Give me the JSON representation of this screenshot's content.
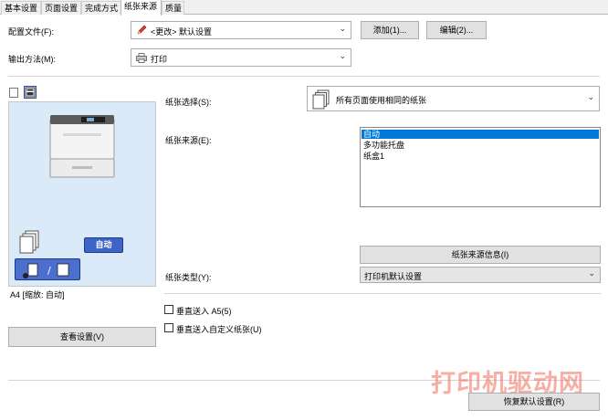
{
  "tabs": [
    "基本设置",
    "页面设置",
    "完成方式",
    "纸张来源",
    "质量"
  ],
  "active_tab_index": 3,
  "profile": {
    "label": "配置文件(F):",
    "value": "<更改> 默认设置",
    "add_label": "添加(1)...",
    "edit_label": "编辑(2)..."
  },
  "output": {
    "label": "输出方法(M):",
    "value": "打印"
  },
  "preview": {
    "auto_button": "自动",
    "caption": "A4 [缩放: 自动]",
    "view_settings": "查看设置(V)"
  },
  "paper_select": {
    "label": "纸张选择(S):",
    "value": "所有页面使用相同的纸张"
  },
  "paper_source": {
    "label": "纸张来源(E):",
    "items": [
      "自动",
      "多功能托盘",
      "纸盒1"
    ],
    "selected_index": 0,
    "info_button": "纸张来源信息(I)"
  },
  "paper_type": {
    "label": "纸张类型(Y):",
    "value": "打印机默认设置"
  },
  "checkboxes": [
    {
      "label": "垂直送入 A5(5)",
      "checked": false
    },
    {
      "label": "垂直送入自定义纸张(U)",
      "checked": false
    }
  ],
  "restore_button": "恢复默认设置(R)",
  "watermark": "打印机驱动网",
  "colors": {
    "accent": "#0078d7",
    "preview_bg": "#dbeaf8",
    "auto_btn": "#3f64c8",
    "watermark": "#f26d5b"
  }
}
